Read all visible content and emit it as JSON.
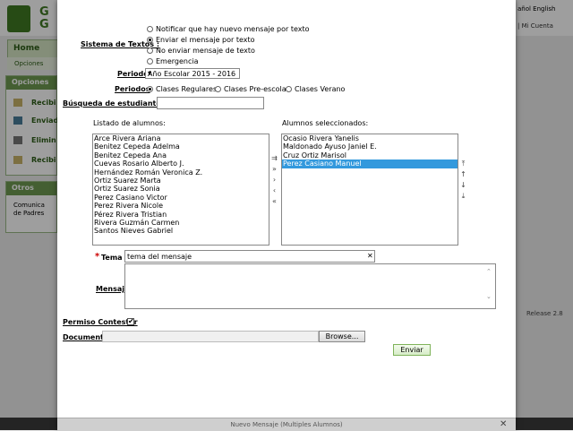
{
  "background": {
    "logo_letters": [
      "G",
      "G"
    ],
    "lang_text": "añol English",
    "account_text": "| Mi Cuenta",
    "nav_home": "Home",
    "nav_sub": "Opciones",
    "panel_options_title": "Opciones",
    "side_items": [
      "Recibi",
      "Enviad",
      "Elimin",
      "Recibi"
    ],
    "panel_otros_title": "Otros",
    "otros_item_line1": "Comunica",
    "otros_item_line2": "de Padres",
    "release": "Release 2.8"
  },
  "modal": {
    "bottom_title": "Nuevo Mensaje (Multiples Alumnos)",
    "close_glyph": "✕",
    "sistema_label": "Sistema de Textos :",
    "sistema_options": [
      {
        "label": "Notificar que hay nuevo mensaje por texto",
        "checked": false
      },
      {
        "label": "Enviar el mensaje por texto",
        "checked": true
      },
      {
        "label": "No enviar mensaje de texto",
        "checked": false
      },
      {
        "label": "Emergencia",
        "checked": false
      }
    ],
    "periodo_label": "Periodo",
    "periodo_value": "Año Escolar 2015 - 2016",
    "periodos_label": "Periodos",
    "periodos_options": [
      {
        "label": "Clases Regulares",
        "checked": true
      },
      {
        "label": "Clases Pre-escolar",
        "checked": false
      },
      {
        "label": "Clases Verano",
        "checked": false
      }
    ],
    "busqueda_label": "Búsqueda de estudiante:",
    "busqueda_value": "",
    "listado_label": "Listado de alumnos:",
    "alumnos": [
      "Arce Rivera Ariana",
      "Benitez Cepeda Adelma",
      "Benitez Cepeda Ana",
      "Cuevas Rosario Alberto J.",
      "Hernández Román Veronica Z.",
      "Ortiz Suarez Marta",
      "Ortiz Suarez Sonia",
      "Perez Casiano Victor",
      "Perez Rivera Nicole",
      "Pérez Rivera Tristian",
      "Rivera Guzmán Carmen",
      "Santos Nieves Gabriel"
    ],
    "seleccionados_label": "Alumnos seleccionados:",
    "seleccionados": [
      {
        "name": "Ocasio Rivera Yanelis",
        "selected": false
      },
      {
        "name": "Maldonado Ayuso Janiel E.",
        "selected": false
      },
      {
        "name": "Cruz Ortiz Marisol",
        "selected": false
      },
      {
        "name": "Perez Casiano Manuel",
        "selected": true
      }
    ],
    "transfer_icons": [
      "add-all-icon",
      "add-all-double-icon",
      "add-one-icon",
      "remove-one-icon",
      "remove-all-icon"
    ],
    "order_icons": [
      "move-top-icon",
      "move-up-icon",
      "move-down-icon",
      "move-bottom-icon"
    ],
    "tema_label": "Tema :",
    "tema_value": "tema del mensaje",
    "tema_clear": "✕",
    "mensaje_label": "Mensaje",
    "mensaje_value": "",
    "permiso_label": "Permiso Contestar",
    "permiso_checked": "✔",
    "documento_label": "Documento",
    "browse_label": "Browse...",
    "enviar_label": "Enviar"
  },
  "colors": {
    "brand_green": "#3f7a22",
    "selection_blue": "#3399dd",
    "required_red": "#cc0000"
  }
}
